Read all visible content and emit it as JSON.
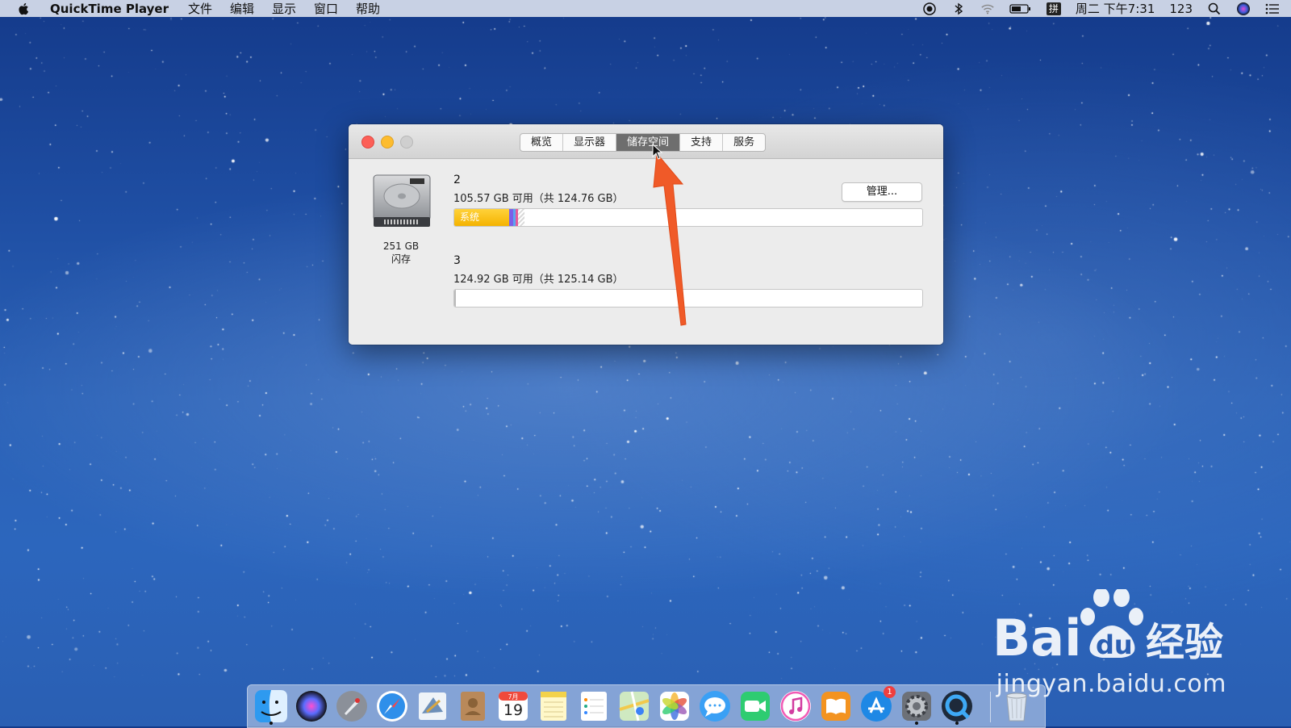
{
  "menubar": {
    "app_name": "QuickTime Player",
    "menus": [
      "文件",
      "编辑",
      "显示",
      "窗口",
      "帮助"
    ],
    "input_method": "拼",
    "datetime": "周二 下午7:31",
    "user": "123"
  },
  "window": {
    "tabs": [
      "概览",
      "显示器",
      "储存空间",
      "支持",
      "服务"
    ],
    "active_tab": "储存空间",
    "disk": {
      "size": "251 GB",
      "type": "闪存"
    },
    "manage_button": "管理...",
    "volumes": [
      {
        "name": "2",
        "info": "105.57 GB 可用（共 124.76 GB）",
        "segment_label": "系统",
        "system_fraction": 0.118,
        "other_fractions": [
          0.008,
          0.006,
          0.005
        ],
        "purgeable_fraction": 0.014
      },
      {
        "name": "3",
        "info": "124.92 GB 可用（共 125.14 GB）"
      }
    ]
  },
  "dock": {
    "items": [
      "finder",
      "siri",
      "launchpad",
      "safari",
      "mail",
      "contacts",
      "calendar",
      "notes",
      "reminders",
      "maps",
      "photos",
      "messages",
      "facetime",
      "itunes",
      "ibooks",
      "app-store",
      "system-preferences",
      "quicktime"
    ],
    "calendar": {
      "month": "7月",
      "day": "19"
    },
    "app_store_badge": "1"
  },
  "watermark": {
    "brand": "Bai du 经验",
    "url": "jingyan.baidu.com"
  },
  "colors": {
    "system_segment": "#f4b300",
    "arrow": "#f05a28",
    "active_tab": "#6e6e6e"
  }
}
